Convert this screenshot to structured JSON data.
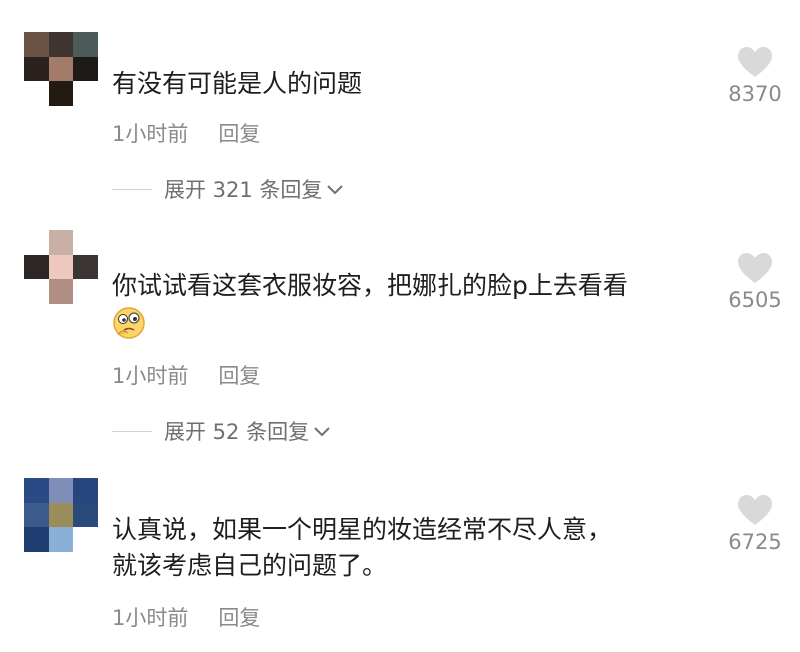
{
  "colors": {
    "text": "#1e1e1e",
    "meta": "#8a8a8a",
    "heart": "#d9d9d9"
  },
  "comments": [
    {
      "avatar_colors": [
        "#6b5244",
        "#3e3430",
        "#4b5b57",
        "#2b2220",
        "#a37b6a",
        "#1d1a18",
        "#ffffff",
        "#231a14",
        "#ffffff"
      ],
      "text": "有没有可能是人的问题",
      "time": "1小时前",
      "reply": "回复",
      "expand": "展开 321 条回复",
      "likes": "8370"
    },
    {
      "avatar_colors": [
        "#ffffff",
        "#c9b0a6",
        "#ffffff",
        "#2c2624",
        "#eec9c0",
        "#3a3432",
        "#ffffff",
        "#b08e84",
        "#ffffff"
      ],
      "text": "你试试看这套衣服妆容，把娜扎的脸p上去看看",
      "emoji": "thinking-emoji",
      "time": "1小时前",
      "reply": "回复",
      "expand": "展开 52 条回复",
      "likes": "6505"
    },
    {
      "avatar_colors": [
        "#2a4a86",
        "#7f8eb6",
        "#28467e",
        "#3d5a8c",
        "#9b8c5c",
        "#2b4a7c",
        "#1f3d70",
        "#8bb0d8",
        "#ffffff"
      ],
      "text_lines": [
        "认真说，如果一个明星的妆造经常不尽人意，",
        "就该考虑自己的问题了。"
      ],
      "time": "1小时前",
      "reply": "回复",
      "likes": "6725"
    }
  ]
}
